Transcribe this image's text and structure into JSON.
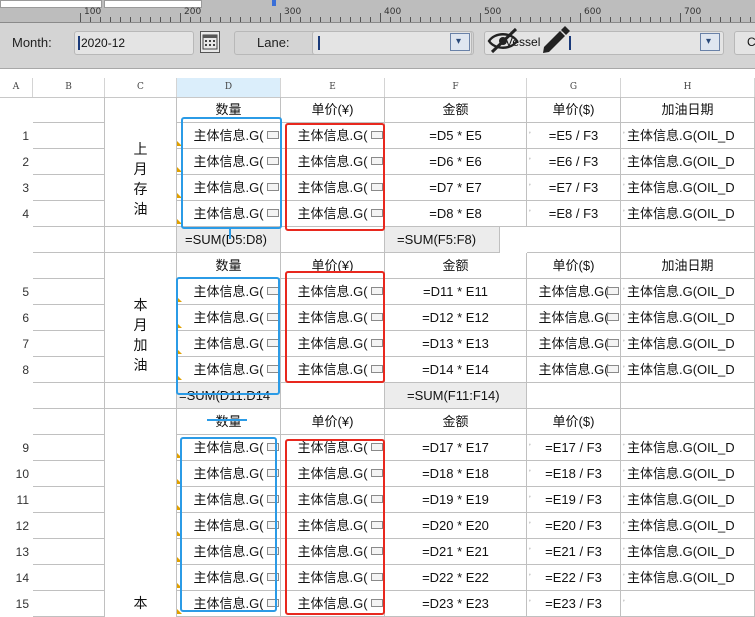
{
  "ruler": {
    "labels": [
      "100",
      "200",
      "300",
      "400",
      "500",
      "600",
      "700"
    ]
  },
  "params": {
    "month_label": "Month:",
    "month_value": "2020-12",
    "lane_label": "Lane:",
    "vessel_label": "Vessel",
    "extra_label": "C",
    "calendar_icon": "calendar-icon",
    "hidden_icon": "eye-off-icon",
    "edit_icon": "pencil-icon"
  },
  "columns": [
    "A",
    "B",
    "C",
    "D",
    "E",
    "F",
    "G",
    "H"
  ],
  "section1": {
    "label": "上\n月\n存\n油",
    "headers": {
      "d": "数量",
      "e": "单价(¥)",
      "f": "金额",
      "g": "单价($)",
      "h": "加油日期"
    },
    "rows": [
      {
        "n": "1",
        "d": "主体信息.G(",
        "e": "主体信息.G(",
        "f": "=D5 * E5",
        "g": "=E5 / F3",
        "h": "主体信息.G(OIL_D"
      },
      {
        "n": "2",
        "d": "主体信息.G(",
        "e": "主体信息.G(",
        "f": "=D6 * E6",
        "g": "=E6 / F3",
        "h": "主体信息.G(OIL_D"
      },
      {
        "n": "3",
        "d": "主体信息.G(",
        "e": "主体信息.G(",
        "f": "=D7 * E7",
        "g": "=E7 / F3",
        "h": "主体信息.G(OIL_D"
      },
      {
        "n": "4",
        "d": "主体信息.G(",
        "e": "主体信息.G(",
        "f": "=D8 * E8",
        "g": "=E8 / F3",
        "h": "主体信息.G(OIL_D"
      }
    ],
    "sum_d": "=SUM(D5:D8)",
    "sum_f": "=SUM(F5:F8)"
  },
  "section2": {
    "label": "本\n月\n加\n油",
    "headers": {
      "d": "数量",
      "e": "单价(¥)",
      "f": "金额",
      "g": "单价($)",
      "h": "加油日期"
    },
    "rows": [
      {
        "n": "5",
        "d": "主体信息.G(",
        "e": "主体信息.G(",
        "f": "=D11 * E11",
        "g": "主体信息.G(",
        "h": "主体信息.G(OIL_D"
      },
      {
        "n": "6",
        "d": "主体信息.G(",
        "e": "主体信息.G(",
        "f": "=D12 * E12",
        "g": "主体信息.G(",
        "h": "主体信息.G(OIL_D"
      },
      {
        "n": "7",
        "d": "主体信息.G(",
        "e": "主体信息.G(",
        "f": "=D13 * E13",
        "g": "主体信息.G(",
        "h": "主体信息.G(OIL_D"
      },
      {
        "n": "8",
        "d": "主体信息.G(",
        "e": "主体信息.G(",
        "f": "=D14 * E14",
        "g": "主体信息.G(",
        "h": "主体信息.G(OIL_D"
      }
    ],
    "sum_d": "=SUM(D11:D14",
    "sum_f": "=SUM(F11:F14)"
  },
  "section3": {
    "label": "本",
    "headers": {
      "d": "数量",
      "e": "单价(¥)",
      "f": "金额",
      "g": "单价($)"
    },
    "rows": [
      {
        "n": "9",
        "d": "主体信息.G(",
        "e": "主体信息.G(",
        "f": "=D17 * E17",
        "g": "=E17 / F3",
        "h": "主体信息.G(OIL_D"
      },
      {
        "n": "10",
        "d": "主体信息.G(",
        "e": "主体信息.G(",
        "f": "=D18 * E18",
        "g": "=E18 / F3",
        "h": "主体信息.G(OIL_D"
      },
      {
        "n": "11",
        "d": "主体信息.G(",
        "e": "主体信息.G(",
        "f": "=D19 * E19",
        "g": "=E19 / F3",
        "h": "主体信息.G(OIL_D"
      },
      {
        "n": "12",
        "d": "主体信息.G(",
        "e": "主体信息.G(",
        "f": "=D20 * E20",
        "g": "=E20 / F3",
        "h": "主体信息.G(OIL_D"
      },
      {
        "n": "13",
        "d": "主体信息.G(",
        "e": "主体信息.G(",
        "f": "=D21 * E21",
        "g": "=E21 / F3",
        "h": "主体信息.G(OIL_D"
      },
      {
        "n": "14",
        "d": "主体信息.G(",
        "e": "主体信息.G(",
        "f": "=D22 * E22",
        "g": "=E22 / F3",
        "h": "主体信息.G(OIL_D"
      },
      {
        "n": "15",
        "d": "主体信息.G(",
        "e": "主体信息.G(",
        "f": "=D23 * E23",
        "g": "=E23 / F3",
        "h": ""
      }
    ]
  }
}
